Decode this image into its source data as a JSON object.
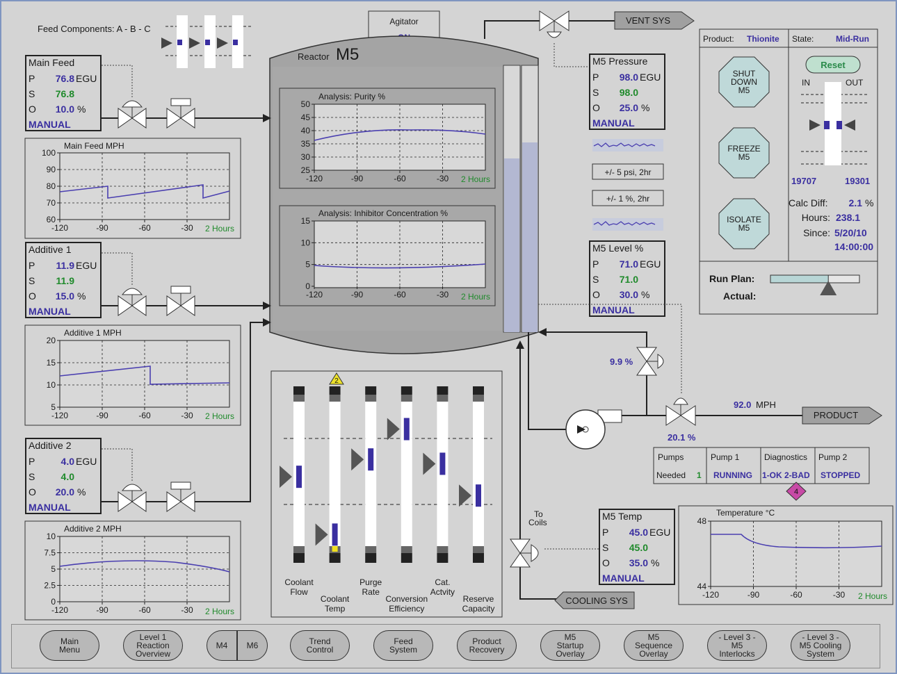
{
  "feed_components": "Feed Components: A - B - C",
  "agitator": {
    "title": "Agitator",
    "state": "ON"
  },
  "reactor": {
    "label": "Reactor",
    "name": "M5"
  },
  "vent": "VENT SYS",
  "product_out": "PRODUCT",
  "cooling_sys": "COOLING SYS",
  "to_coils": "To\nCoils",
  "main_feed": {
    "title": "Main Feed",
    "p": "76.8",
    "s": "76.8",
    "o": "10.0",
    "egu": "EGU",
    "pct": "%",
    "mode": "MANUAL"
  },
  "additive1": {
    "title": "Additive 1",
    "p": "11.9",
    "s": "11.9",
    "o": "15.0",
    "egu": "EGU",
    "pct": "%",
    "mode": "MANUAL"
  },
  "additive2": {
    "title": "Additive 2",
    "p": "4.0",
    "s": "4.0",
    "o": "20.0",
    "egu": "EGU",
    "pct": "%",
    "mode": "MANUAL"
  },
  "m5_pressure": {
    "title": "M5 Pressure",
    "p": "98.0",
    "s": "98.0",
    "o": "25.0",
    "egu": "EGU",
    "pct": "%",
    "mode": "MANUAL"
  },
  "m5_level": {
    "title": "M5 Level %",
    "p": "71.0",
    "s": "71.0",
    "o": "30.0",
    "egu": "EGU",
    "pct": "%",
    "mode": "MANUAL"
  },
  "m5_temp": {
    "title": "M5 Temp",
    "p": "45.0",
    "s": "45.0",
    "o": "35.0",
    "egu": "EGU",
    "pct": "%",
    "mode": "MANUAL"
  },
  "row_labels": {
    "p": "P",
    "s": "S",
    "o": "O"
  },
  "pressure_band": "+/- 5 psi, 2hr",
  "level_band": "+/- 1 %, 2hr",
  "product_flow": {
    "value": "92.0",
    "unit": "MPH"
  },
  "valve_recycle_pct": "9.9 %",
  "valve_product_pct": "20.1 %",
  "pumps": {
    "pumps": "Pumps",
    "needed": "Needed",
    "needed_val": "1",
    "pump1": "Pump 1",
    "pump1_state": "RUNNING",
    "diag": "Diagnostics",
    "diag_state": "1-OK  2-BAD",
    "pump2": "Pump 2",
    "pump2_state": "STOPPED",
    "badge": "4"
  },
  "status": {
    "product_label": "Product:",
    "product": "Thionite",
    "state_label": "State:",
    "state": "Mid-Run"
  },
  "cmd": {
    "shutdown": "SHUT\nDOWN\nM5",
    "freeze": "FREEZE\nM5",
    "isolate": "ISOLATE\nM5"
  },
  "balance": {
    "reset": "Reset",
    "in": "IN",
    "out": "OUT",
    "in_val": "19707",
    "out_val": "19301",
    "calc_label": "Calc Diff:",
    "calc_val": "2.1",
    "calc_unit": "%",
    "hours_label": "Hours:",
    "hours_val": "238.1",
    "since_label": "Since:",
    "since_date": "5/20/10",
    "since_time": "14:00:00"
  },
  "run_plan": {
    "plan": "Run Plan:",
    "actual": "Actual:",
    "progress": 0.65
  },
  "gauges": {
    "badge": "2",
    "labels": [
      [
        "Coolant",
        "Flow"
      ],
      [
        "Coolant",
        "Temp"
      ],
      [
        "Purge",
        "Rate"
      ],
      [
        "Conversion",
        "Efficiency"
      ],
      [
        "Cat.",
        "Actvity"
      ],
      [
        "Reserve",
        "Capacity"
      ]
    ],
    "positions": [
      0.52,
      0.92,
      0.4,
      0.19,
      0.43,
      0.65
    ]
  },
  "charts": {
    "purity": {
      "title": "Analysis: Purity %",
      "xlabel": "2 Hours",
      "yticks": [
        "50",
        "45",
        "40",
        "35",
        "30",
        "25"
      ],
      "xticks": [
        "-120",
        "-90",
        "-60",
        "-30"
      ]
    },
    "inhibitor": {
      "title": "Analysis: Inhibitor Concentration %",
      "xlabel": "2 Hours",
      "yticks": [
        "15",
        "10",
        "5",
        "0"
      ],
      "xticks": [
        "-120",
        "-90",
        "-60",
        "-30"
      ]
    },
    "main_feed_mph": {
      "title": "Main Feed MPH",
      "xlabel": "2 Hours",
      "yticks": [
        "100",
        "90",
        "80",
        "70",
        "60"
      ],
      "xticks": [
        "-120",
        "-90",
        "-60",
        "-30"
      ]
    },
    "add1_mph": {
      "title": "Additive 1 MPH",
      "xlabel": "2 Hours",
      "yticks": [
        "20",
        "15",
        "10",
        "5"
      ],
      "xticks": [
        "-120",
        "-90",
        "-60",
        "-30"
      ]
    },
    "add2_mph": {
      "title": "Additive 2 MPH",
      "xlabel": "2 Hours",
      "yticks": [
        "10",
        "7.5",
        "5",
        "2.5",
        "0"
      ],
      "xticks": [
        "-120",
        "-90",
        "-60",
        "-30"
      ]
    },
    "temperature": {
      "title": "Temperature °C",
      "xlabel": "2 Hours",
      "yticks": [
        "48",
        "44"
      ],
      "xticks": [
        "-120",
        "-90",
        "-60",
        "-30"
      ]
    }
  },
  "nav": [
    {
      "label": "Main\nMenu"
    },
    {
      "label": "Level 1\nReaction\nOverview"
    },
    {
      "label": "M4"
    },
    {
      "label": "M6"
    },
    {
      "label": "Trend\nControl"
    },
    {
      "label": "Feed\nSystem"
    },
    {
      "label": "Product\nRecovery"
    },
    {
      "label": "M5\nStartup\nOverlay"
    },
    {
      "label": "M5\nSequence\nOverlay"
    },
    {
      "label": "- Level 3 -\nM5\nInterlocks"
    },
    {
      "label": "- Level 3 -\nM5 Cooling\nSystem"
    }
  ]
}
